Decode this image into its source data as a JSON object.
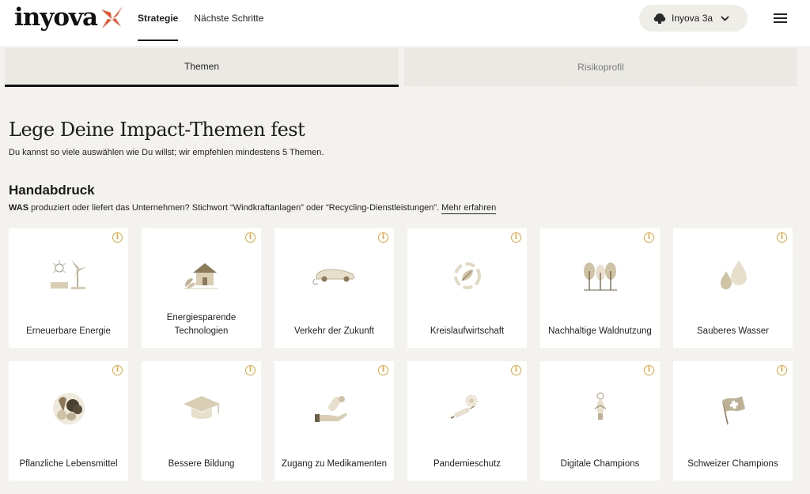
{
  "header": {
    "logo_text": "inyova",
    "nav": [
      {
        "label": "Strategie",
        "active": true
      },
      {
        "label": "Nächste Schritte",
        "active": false
      }
    ],
    "account_label": "Inyova 3a"
  },
  "tabs": [
    {
      "label": "Themen",
      "active": true
    },
    {
      "label": "Risikoprofil",
      "active": false
    }
  ],
  "page": {
    "title": "Lege Deine Impact-Themen fest",
    "subtitle": "Du kannst so viele auswählen wie Du willst; wir empfehlen mindestens 5 Themen."
  },
  "section": {
    "title": "Handabdruck",
    "desc_bold": "WAS",
    "desc_text": " produziert oder liefert das Unternehmen? Stichwort “Windkraftanlagen” oder “Recycling-Dienstleistungen”.",
    "more_link": "Mehr erfahren"
  },
  "info_glyph": "i",
  "cards": [
    {
      "label": "Erneuerbare Energie",
      "icon": "renewable-energy-icon"
    },
    {
      "label": "Energiesparende Technologien",
      "icon": "energy-saving-house-icon"
    },
    {
      "label": "Verkehr der Zukunft",
      "icon": "electric-car-icon"
    },
    {
      "label": "Kreislaufwirtschaft",
      "icon": "recycling-leaf-icon"
    },
    {
      "label": "Nachhaltige Waldnutzung",
      "icon": "trees-icon"
    },
    {
      "label": "Sauberes Wasser",
      "icon": "water-drops-icon"
    },
    {
      "label": "Pflanzliche Lebensmittel",
      "icon": "vegetables-icon"
    },
    {
      "label": "Bessere Bildung",
      "icon": "graduation-cap-icon"
    },
    {
      "label": "Zugang zu Medikamenten",
      "icon": "medicine-hand-icon"
    },
    {
      "label": "Pandemieschutz",
      "icon": "syringe-virus-icon"
    },
    {
      "label": "Digitale Champions",
      "icon": "light-bulb-icon"
    },
    {
      "label": "Schweizer Champions",
      "icon": "swiss-flag-icon"
    }
  ],
  "colors": {
    "background": "#f4f2ee",
    "card": "#ffffff",
    "accent_orange": "#e8522a",
    "info_yellow": "#e3a43a",
    "illustration_beige": "#d9cdb3"
  }
}
